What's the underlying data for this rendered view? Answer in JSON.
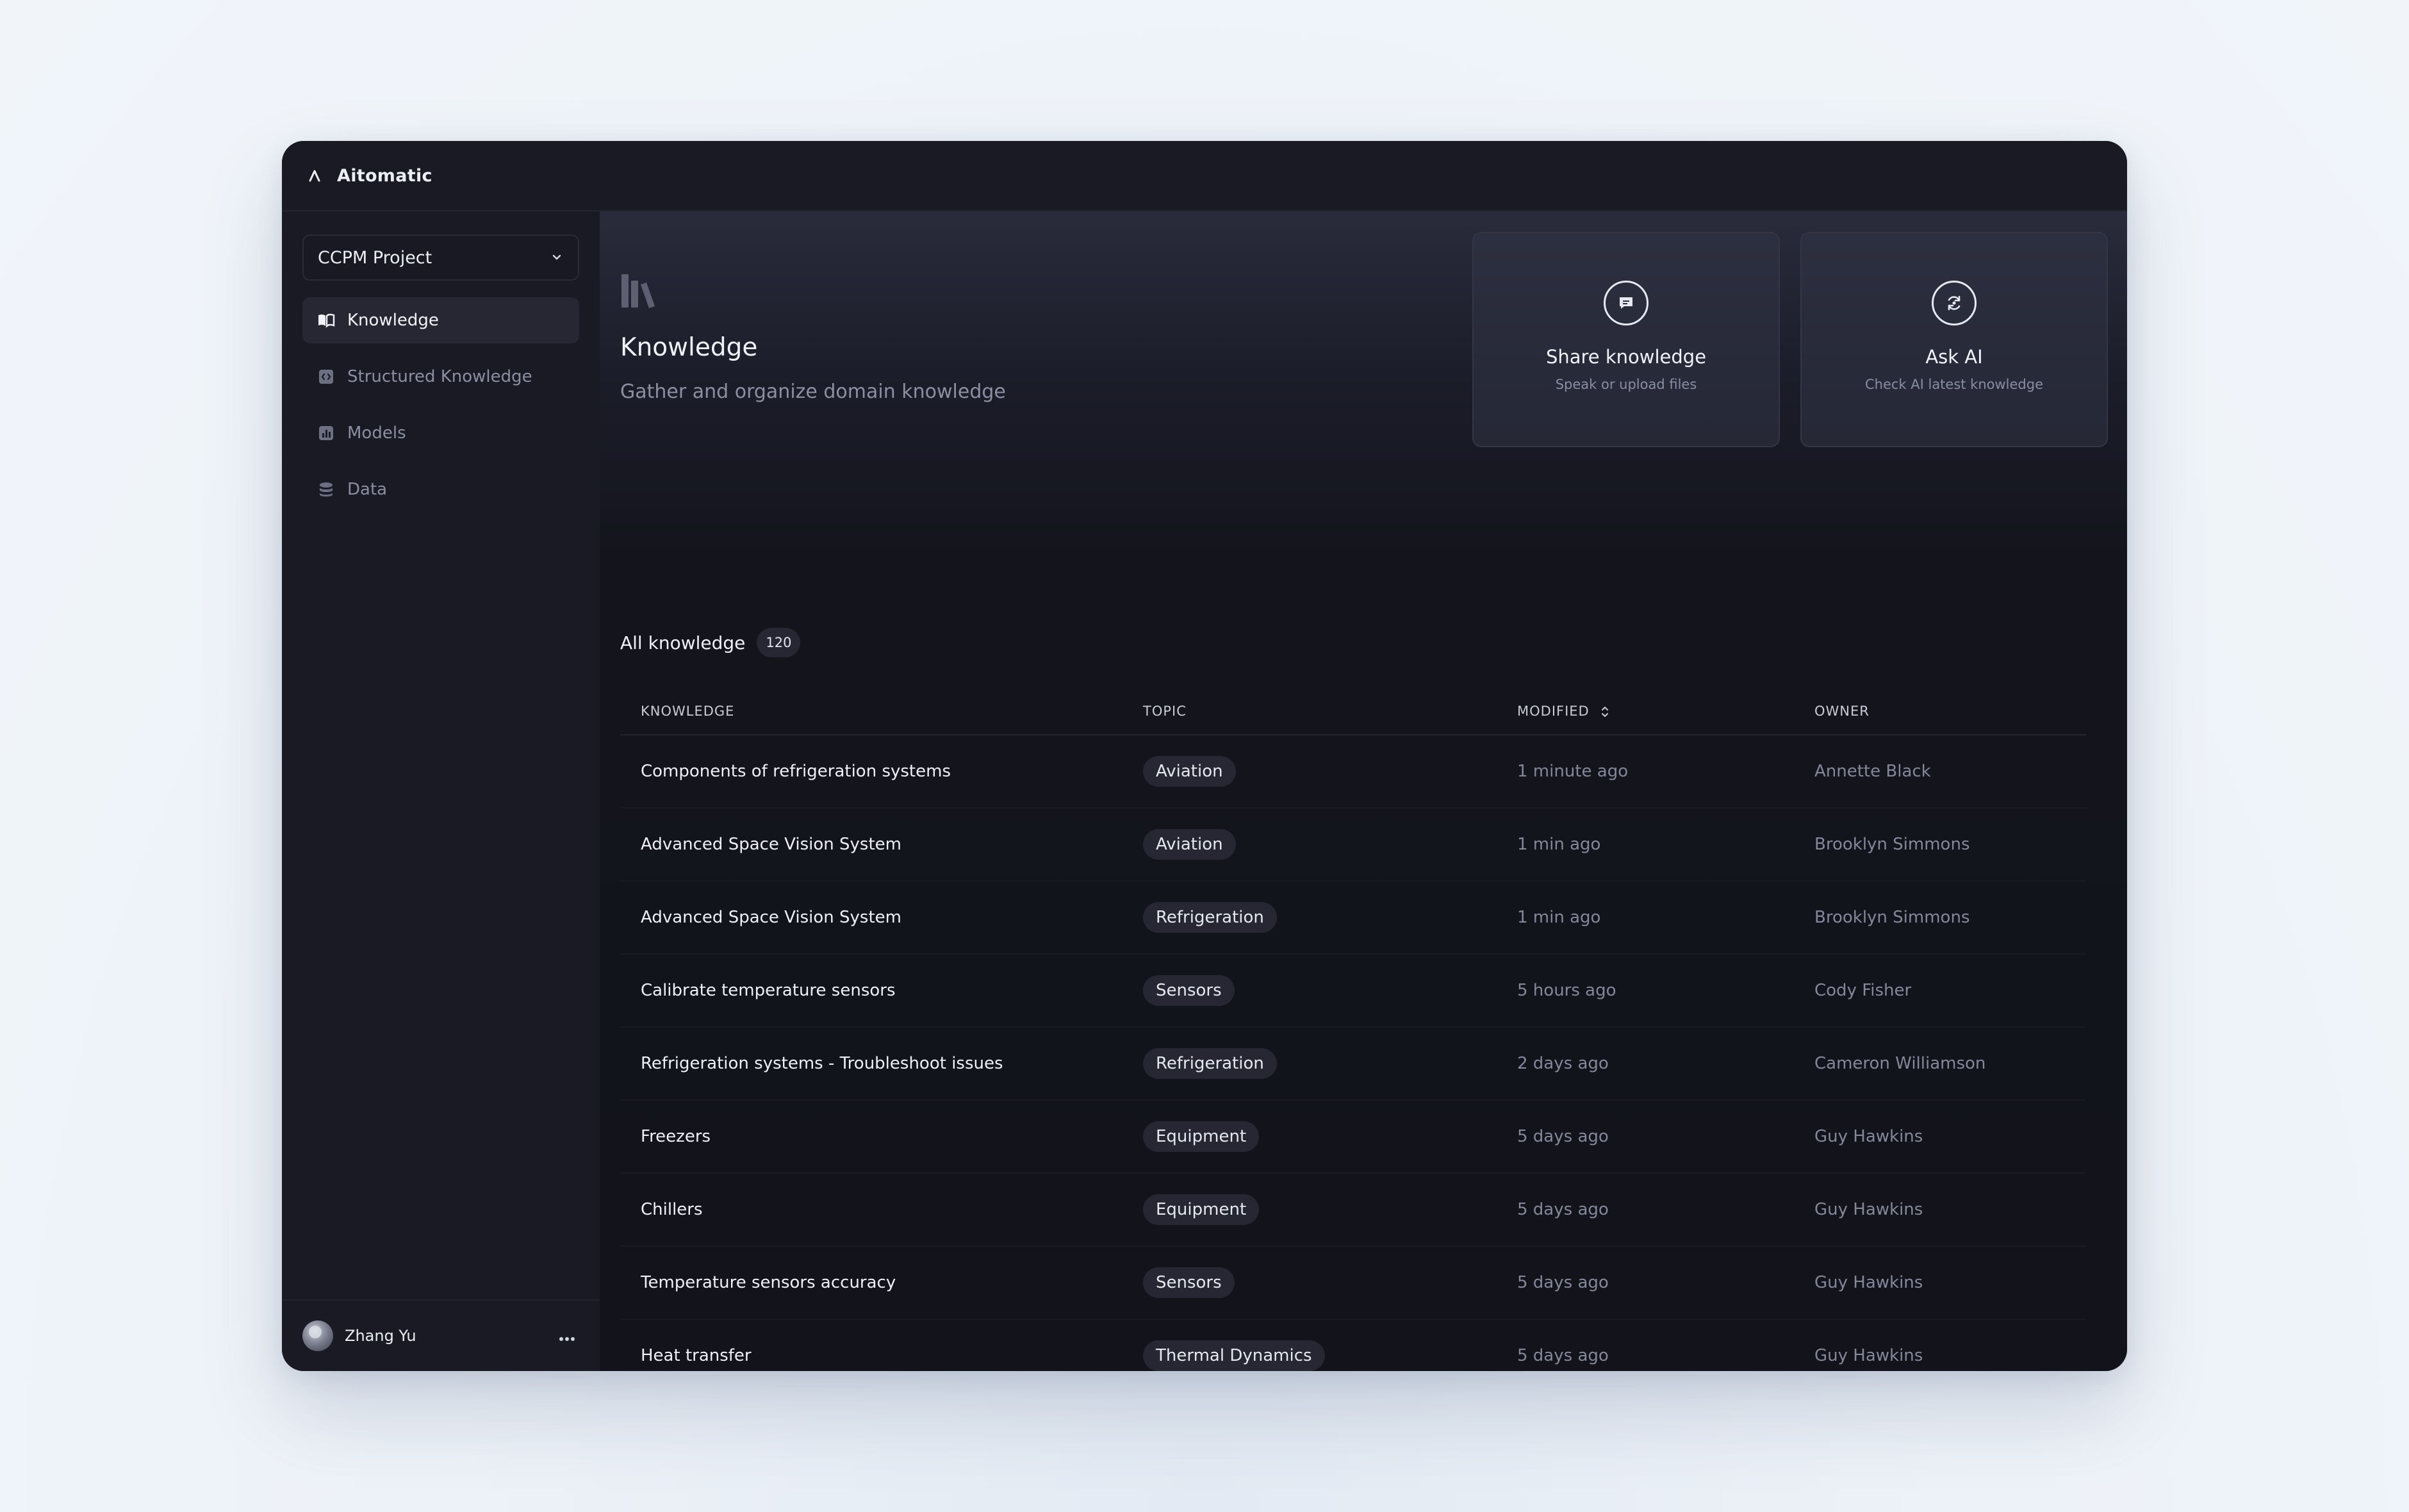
{
  "app": {
    "title": "Aitomatic"
  },
  "sidebar": {
    "project_select": {
      "value": "CCPM Project"
    },
    "items": [
      {
        "label": "Knowledge",
        "icon": "book-open-icon",
        "active": true
      },
      {
        "label": "Structured Knowledge",
        "icon": "code-box-icon",
        "active": false
      },
      {
        "label": "Models",
        "icon": "bar-chart-icon",
        "active": false
      },
      {
        "label": "Data",
        "icon": "database-icon",
        "active": false
      }
    ],
    "user": {
      "name": "Zhang Yu"
    }
  },
  "header": {
    "title": "Knowledge",
    "subtitle": "Gather and organize domain knowledge"
  },
  "actions": [
    {
      "title": "Share knowledge",
      "subtitle": "Speak or upload files",
      "icon": "message-icon"
    },
    {
      "title": "Ask AI",
      "subtitle": "Check AI latest knowledge",
      "icon": "refresh-icon"
    }
  ],
  "list": {
    "title": "All knowledge",
    "count": "120",
    "columns": [
      "KNOWLEDGE",
      "TOPIC",
      "MODIFIED",
      "OWNER"
    ],
    "rows": [
      {
        "title": "Components of refrigeration systems",
        "topic": "Aviation",
        "modified": "1 minute ago",
        "owner": "Annette Black"
      },
      {
        "title": "Advanced Space Vision System",
        "topic": "Aviation",
        "modified": "1 min ago",
        "owner": "Brooklyn Simmons"
      },
      {
        "title": "Advanced Space Vision System",
        "topic": "Refrigeration",
        "modified": "1 min ago",
        "owner": "Brooklyn Simmons"
      },
      {
        "title": "Calibrate temperature sensors",
        "topic": "Sensors",
        "modified": "5 hours ago",
        "owner": "Cody Fisher"
      },
      {
        "title": "Refrigeration systems - Troubleshoot issues",
        "topic": "Refrigeration",
        "modified": "2 days ago",
        "owner": "Cameron Williamson"
      },
      {
        "title": "Freezers",
        "topic": "Equipment",
        "modified": "5 days ago",
        "owner": "Guy Hawkins"
      },
      {
        "title": "Chillers",
        "topic": "Equipment",
        "modified": "5 days ago",
        "owner": "Guy Hawkins"
      },
      {
        "title": "Temperature sensors accuracy",
        "topic": "Sensors",
        "modified": "5 days ago",
        "owner": "Guy Hawkins"
      },
      {
        "title": "Heat transfer",
        "topic": "Thermal Dynamics",
        "modified": "5 days ago",
        "owner": "Guy Hawkins"
      }
    ]
  },
  "colors": {
    "window_bg": "#14151d",
    "sidebar_bg": "#191a24",
    "active_item_bg": "#262733",
    "text_primary": "#eef0f6",
    "text_muted": "#85879a",
    "page_bg": "#edf2f8"
  }
}
